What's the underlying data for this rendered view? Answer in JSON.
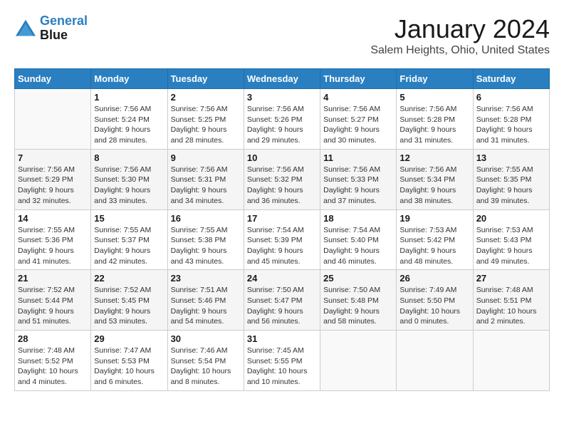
{
  "logo": {
    "line1": "General",
    "line2": "Blue"
  },
  "title": "January 2024",
  "subtitle": "Salem Heights, Ohio, United States",
  "days_header": [
    "Sunday",
    "Monday",
    "Tuesday",
    "Wednesday",
    "Thursday",
    "Friday",
    "Saturday"
  ],
  "weeks": [
    [
      {
        "num": "",
        "info": ""
      },
      {
        "num": "1",
        "info": "Sunrise: 7:56 AM\nSunset: 5:24 PM\nDaylight: 9 hours\nand 28 minutes."
      },
      {
        "num": "2",
        "info": "Sunrise: 7:56 AM\nSunset: 5:25 PM\nDaylight: 9 hours\nand 28 minutes."
      },
      {
        "num": "3",
        "info": "Sunrise: 7:56 AM\nSunset: 5:26 PM\nDaylight: 9 hours\nand 29 minutes."
      },
      {
        "num": "4",
        "info": "Sunrise: 7:56 AM\nSunset: 5:27 PM\nDaylight: 9 hours\nand 30 minutes."
      },
      {
        "num": "5",
        "info": "Sunrise: 7:56 AM\nSunset: 5:28 PM\nDaylight: 9 hours\nand 31 minutes."
      },
      {
        "num": "6",
        "info": "Sunrise: 7:56 AM\nSunset: 5:28 PM\nDaylight: 9 hours\nand 31 minutes."
      }
    ],
    [
      {
        "num": "7",
        "info": "Sunrise: 7:56 AM\nSunset: 5:29 PM\nDaylight: 9 hours\nand 32 minutes."
      },
      {
        "num": "8",
        "info": "Sunrise: 7:56 AM\nSunset: 5:30 PM\nDaylight: 9 hours\nand 33 minutes."
      },
      {
        "num": "9",
        "info": "Sunrise: 7:56 AM\nSunset: 5:31 PM\nDaylight: 9 hours\nand 34 minutes."
      },
      {
        "num": "10",
        "info": "Sunrise: 7:56 AM\nSunset: 5:32 PM\nDaylight: 9 hours\nand 36 minutes."
      },
      {
        "num": "11",
        "info": "Sunrise: 7:56 AM\nSunset: 5:33 PM\nDaylight: 9 hours\nand 37 minutes."
      },
      {
        "num": "12",
        "info": "Sunrise: 7:56 AM\nSunset: 5:34 PM\nDaylight: 9 hours\nand 38 minutes."
      },
      {
        "num": "13",
        "info": "Sunrise: 7:55 AM\nSunset: 5:35 PM\nDaylight: 9 hours\nand 39 minutes."
      }
    ],
    [
      {
        "num": "14",
        "info": "Sunrise: 7:55 AM\nSunset: 5:36 PM\nDaylight: 9 hours\nand 41 minutes."
      },
      {
        "num": "15",
        "info": "Sunrise: 7:55 AM\nSunset: 5:37 PM\nDaylight: 9 hours\nand 42 minutes."
      },
      {
        "num": "16",
        "info": "Sunrise: 7:55 AM\nSunset: 5:38 PM\nDaylight: 9 hours\nand 43 minutes."
      },
      {
        "num": "17",
        "info": "Sunrise: 7:54 AM\nSunset: 5:39 PM\nDaylight: 9 hours\nand 45 minutes."
      },
      {
        "num": "18",
        "info": "Sunrise: 7:54 AM\nSunset: 5:40 PM\nDaylight: 9 hours\nand 46 minutes."
      },
      {
        "num": "19",
        "info": "Sunrise: 7:53 AM\nSunset: 5:42 PM\nDaylight: 9 hours\nand 48 minutes."
      },
      {
        "num": "20",
        "info": "Sunrise: 7:53 AM\nSunset: 5:43 PM\nDaylight: 9 hours\nand 49 minutes."
      }
    ],
    [
      {
        "num": "21",
        "info": "Sunrise: 7:52 AM\nSunset: 5:44 PM\nDaylight: 9 hours\nand 51 minutes."
      },
      {
        "num": "22",
        "info": "Sunrise: 7:52 AM\nSunset: 5:45 PM\nDaylight: 9 hours\nand 53 minutes."
      },
      {
        "num": "23",
        "info": "Sunrise: 7:51 AM\nSunset: 5:46 PM\nDaylight: 9 hours\nand 54 minutes."
      },
      {
        "num": "24",
        "info": "Sunrise: 7:50 AM\nSunset: 5:47 PM\nDaylight: 9 hours\nand 56 minutes."
      },
      {
        "num": "25",
        "info": "Sunrise: 7:50 AM\nSunset: 5:48 PM\nDaylight: 9 hours\nand 58 minutes."
      },
      {
        "num": "26",
        "info": "Sunrise: 7:49 AM\nSunset: 5:50 PM\nDaylight: 10 hours\nand 0 minutes."
      },
      {
        "num": "27",
        "info": "Sunrise: 7:48 AM\nSunset: 5:51 PM\nDaylight: 10 hours\nand 2 minutes."
      }
    ],
    [
      {
        "num": "28",
        "info": "Sunrise: 7:48 AM\nSunset: 5:52 PM\nDaylight: 10 hours\nand 4 minutes."
      },
      {
        "num": "29",
        "info": "Sunrise: 7:47 AM\nSunset: 5:53 PM\nDaylight: 10 hours\nand 6 minutes."
      },
      {
        "num": "30",
        "info": "Sunrise: 7:46 AM\nSunset: 5:54 PM\nDaylight: 10 hours\nand 8 minutes."
      },
      {
        "num": "31",
        "info": "Sunrise: 7:45 AM\nSunset: 5:55 PM\nDaylight: 10 hours\nand 10 minutes."
      },
      {
        "num": "",
        "info": ""
      },
      {
        "num": "",
        "info": ""
      },
      {
        "num": "",
        "info": ""
      }
    ]
  ]
}
